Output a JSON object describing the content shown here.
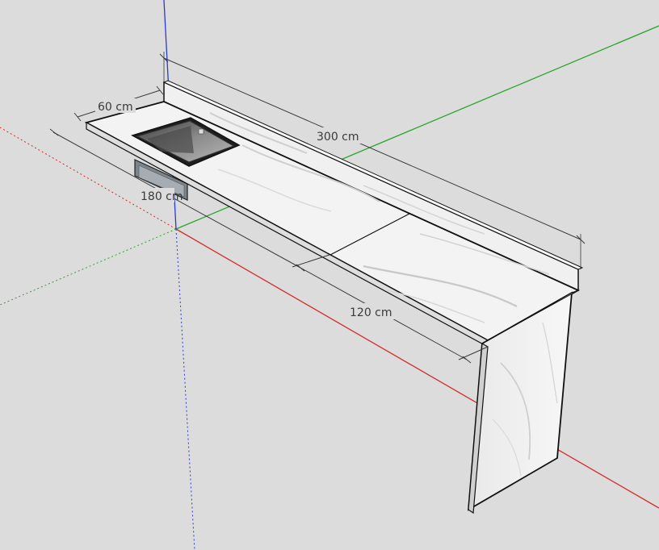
{
  "dimensions": {
    "depth_label": "60 cm",
    "length_label": "300 cm",
    "sink_section_label": "180 cm",
    "waterfall_section_label": "120 cm"
  },
  "colors": {
    "background": "#dcdcdc",
    "axis_red": "#d42a2a",
    "axis_green": "#2aa52a",
    "axis_blue": "#2a3ad4",
    "marble": "#f2f2f2",
    "marble_vein": "#c9c9c9",
    "edge": "#111111",
    "dimension_line": "#3a3a3a",
    "sink_basin": "#6f6f6f"
  },
  "model": {
    "objects": [
      "countertop",
      "backsplash",
      "undermount-sink",
      "waterfall-leg",
      "sink-support-bracket"
    ],
    "axes": [
      "red-axis",
      "green-axis",
      "blue-axis"
    ]
  }
}
